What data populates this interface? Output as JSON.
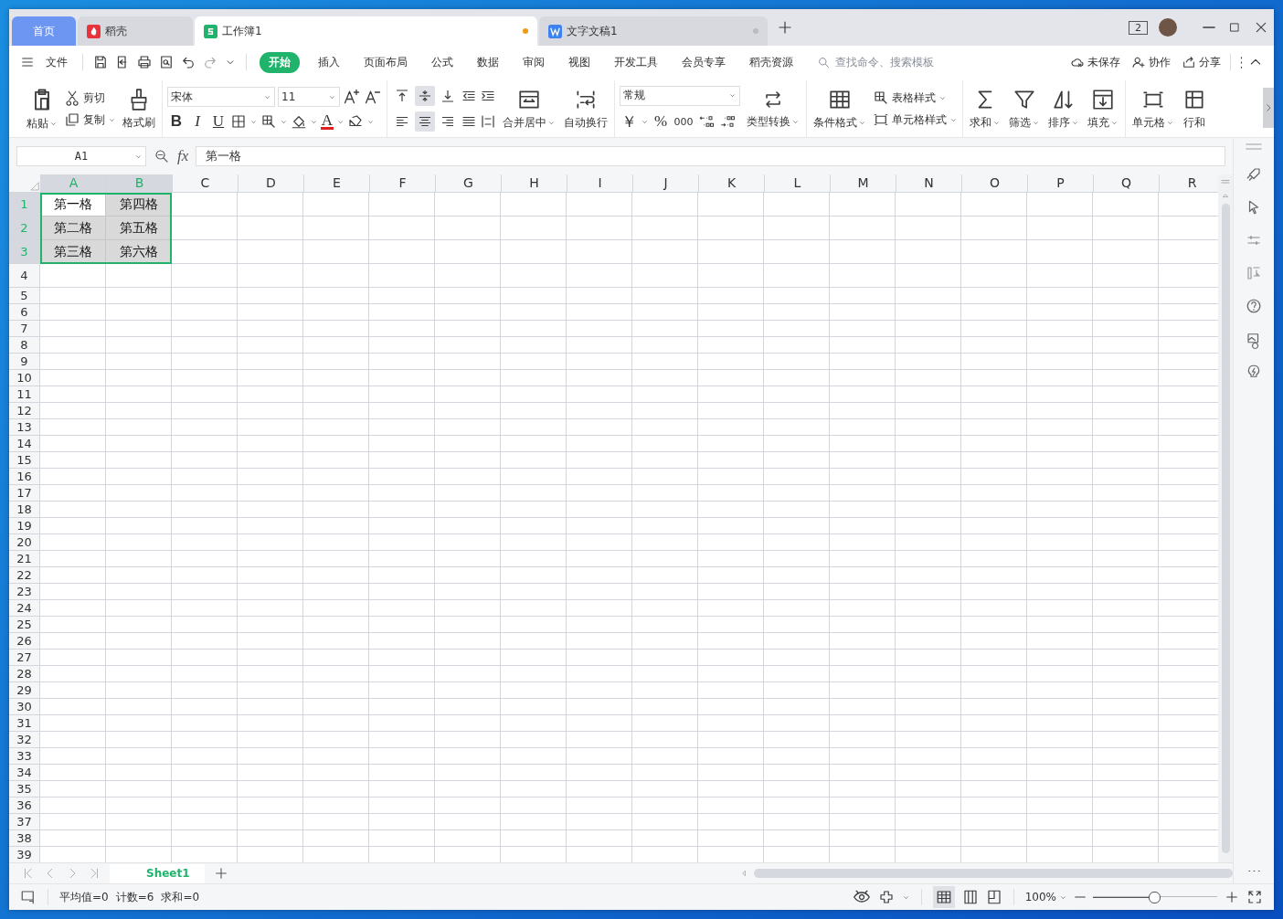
{
  "tabs": [
    {
      "label": "首页",
      "kind": "home",
      "selected": false
    },
    {
      "label": "稻壳",
      "kind": "docer",
      "selected": false
    },
    {
      "label": "工作簿1",
      "kind": "sheet",
      "selected": true
    },
    {
      "label": "文字文稿1",
      "kind": "writer",
      "selected": false
    }
  ],
  "title_bar": {
    "window_count": "2"
  },
  "menu": {
    "file": "文件",
    "items": [
      {
        "label": "开始",
        "selected": true
      },
      {
        "label": "插入",
        "selected": false
      },
      {
        "label": "页面布局",
        "selected": false
      },
      {
        "label": "公式",
        "selected": false
      },
      {
        "label": "数据",
        "selected": false
      },
      {
        "label": "审阅",
        "selected": false
      },
      {
        "label": "视图",
        "selected": false
      },
      {
        "label": "开发工具",
        "selected": false
      },
      {
        "label": "会员专享",
        "selected": false
      },
      {
        "label": "稻壳资源",
        "selected": false
      }
    ],
    "search": {
      "placeholder": "查找命令、搜索模板"
    },
    "actions": [
      {
        "label": "未保存",
        "kind": "cloud"
      },
      {
        "label": "协作",
        "kind": "collab"
      },
      {
        "label": "分享",
        "kind": "share"
      }
    ]
  },
  "ribbon": {
    "paste": "粘贴",
    "cut": "剪切",
    "copy": "复制",
    "format_painter": "格式刷",
    "font": "宋体",
    "font_size": "11",
    "bold": "B",
    "italic": "I",
    "underline": "U",
    "font_color": "A",
    "align_vertical": [
      {
        "selected": false
      },
      {
        "selected": true
      },
      {
        "selected": false
      }
    ],
    "align_horizontal": [
      {
        "selected": false
      },
      {
        "selected": true
      },
      {
        "selected": false
      }
    ],
    "merge": "合并居中",
    "wrap": "自动换行",
    "number_format": "常规",
    "currency": "￥",
    "percent": "%",
    "thousands": "000",
    "convert": "类型转换",
    "conditional": "条件格式",
    "table_style": "表格样式",
    "cell_style": "单元格样式",
    "sum": "求和",
    "filter": "筛选",
    "sort": "排序",
    "fill": "填充",
    "cells": "单元格",
    "rows_cols": "行和"
  },
  "formula_bar": {
    "name_box": "A1",
    "fx": "fx",
    "value": "第一格"
  },
  "grid": {
    "columns": [
      {
        "label": "A",
        "selected": true
      },
      {
        "label": "B",
        "selected": true
      },
      {
        "label": "C",
        "selected": false
      },
      {
        "label": "D",
        "selected": false
      },
      {
        "label": "E",
        "selected": false
      },
      {
        "label": "F",
        "selected": false
      },
      {
        "label": "G",
        "selected": false
      },
      {
        "label": "H",
        "selected": false
      },
      {
        "label": "I",
        "selected": false
      },
      {
        "label": "J",
        "selected": false
      },
      {
        "label": "K",
        "selected": false
      },
      {
        "label": "L",
        "selected": false
      },
      {
        "label": "M",
        "selected": false
      },
      {
        "label": "N",
        "selected": false
      },
      {
        "label": "O",
        "selected": false
      },
      {
        "label": "P",
        "selected": false
      },
      {
        "label": "Q",
        "selected": false
      },
      {
        "label": "R",
        "selected": false
      }
    ],
    "rows": [
      {
        "label": "1",
        "selected": true,
        "cells": [
          {
            "text": "第一格",
            "active": true
          },
          {
            "text": "第四格",
            "active": false
          }
        ]
      },
      {
        "label": "2",
        "selected": true,
        "cells": [
          {
            "text": "第二格",
            "active": false
          },
          {
            "text": "第五格",
            "active": false
          }
        ]
      },
      {
        "label": "3",
        "selected": true,
        "cells": [
          {
            "text": "第三格",
            "active": false
          },
          {
            "text": "第六格",
            "active": false
          }
        ]
      },
      {
        "label": "4",
        "selected": false
      },
      {
        "label": "5",
        "selected": false
      },
      {
        "label": "6",
        "selected": false
      },
      {
        "label": "7",
        "selected": false
      },
      {
        "label": "8",
        "selected": false
      },
      {
        "label": "9",
        "selected": false
      },
      {
        "label": "10",
        "selected": false
      },
      {
        "label": "11",
        "selected": false
      },
      {
        "label": "12",
        "selected": false
      },
      {
        "label": "13",
        "selected": false
      },
      {
        "label": "14",
        "selected": false
      },
      {
        "label": "15",
        "selected": false
      },
      {
        "label": "16",
        "selected": false
      },
      {
        "label": "17",
        "selected": false
      },
      {
        "label": "18",
        "selected": false
      },
      {
        "label": "19",
        "selected": false
      },
      {
        "label": "20",
        "selected": false
      },
      {
        "label": "21",
        "selected": false
      },
      {
        "label": "22",
        "selected": false
      },
      {
        "label": "23",
        "selected": false
      },
      {
        "label": "24",
        "selected": false
      },
      {
        "label": "25",
        "selected": false
      },
      {
        "label": "26",
        "selected": false
      },
      {
        "label": "27",
        "selected": false
      },
      {
        "label": "28",
        "selected": false
      },
      {
        "label": "29",
        "selected": false
      },
      {
        "label": "30",
        "selected": false
      },
      {
        "label": "31",
        "selected": false
      },
      {
        "label": "32",
        "selected": false
      },
      {
        "label": "33",
        "selected": false
      },
      {
        "label": "34",
        "selected": false
      },
      {
        "label": "35",
        "selected": false
      },
      {
        "label": "36",
        "selected": false
      },
      {
        "label": "37",
        "selected": false
      },
      {
        "label": "38",
        "selected": false
      },
      {
        "label": "39",
        "selected": false
      }
    ]
  },
  "sheets": [
    {
      "label": "Sheet1",
      "selected": true
    }
  ],
  "status_bar": {
    "stats": [
      "平均值=0",
      "计数=6",
      "求和=0"
    ],
    "zoom": "100%",
    "zoom_slider": {
      "level": 0.49
    }
  }
}
